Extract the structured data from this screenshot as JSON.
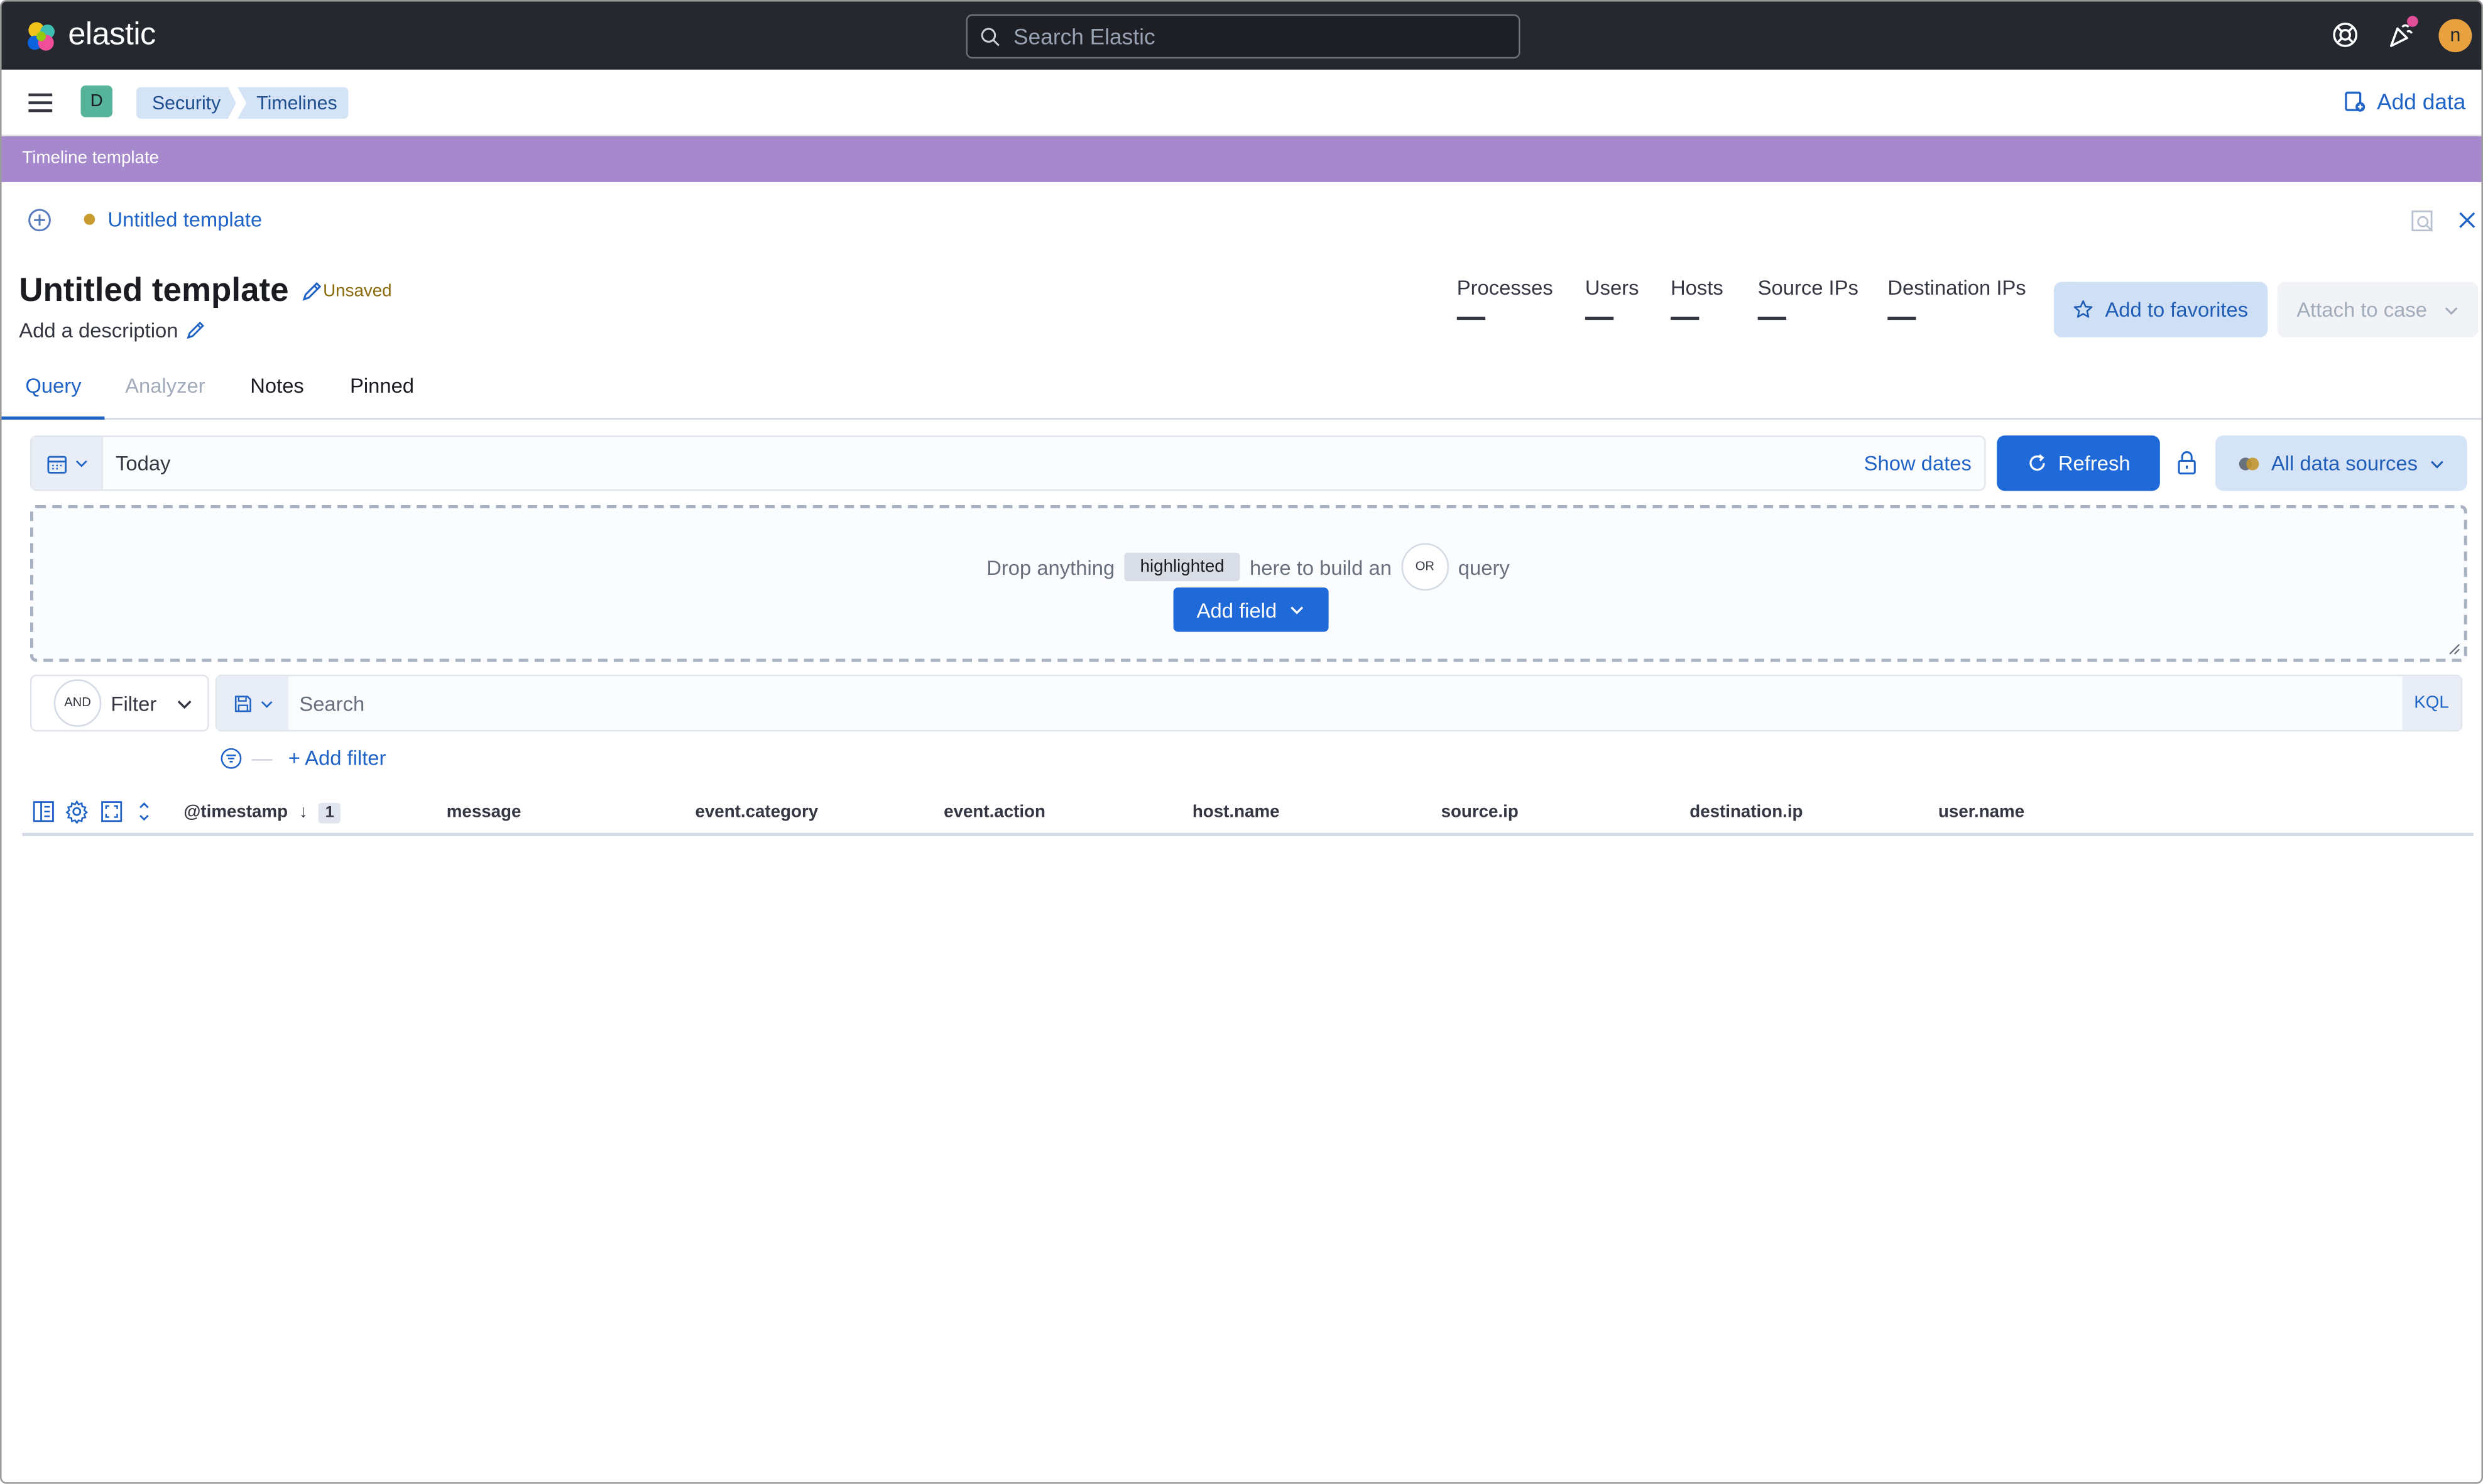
{
  "header": {
    "logo_text": "elastic",
    "search_placeholder": "Search Elastic",
    "avatar_initial": "n"
  },
  "nav": {
    "space_initial": "D",
    "breadcrumbs": [
      "Security",
      "Timelines"
    ],
    "add_data_label": "Add data"
  },
  "banner": {
    "text": "Timeline template"
  },
  "timeline": {
    "tab_title": "Untitled template",
    "title": "Untitled template",
    "status": "Unsaved",
    "description_placeholder": "Add a description",
    "kpis": [
      {
        "label": "Processes",
        "value": "—"
      },
      {
        "label": "Users",
        "value": "—"
      },
      {
        "label": "Hosts",
        "value": "—"
      },
      {
        "label": "Source IPs",
        "value": "—"
      },
      {
        "label": "Destination IPs",
        "value": "—"
      }
    ],
    "favorites_label": "Add to favorites",
    "attach_label": "Attach to case"
  },
  "tabs": [
    {
      "label": "Query",
      "state": "active"
    },
    {
      "label": "Analyzer",
      "state": "disabled"
    },
    {
      "label": "Notes",
      "state": "normal"
    },
    {
      "label": "Pinned",
      "state": "normal"
    }
  ],
  "query": {
    "date_value": "Today",
    "show_dates_label": "Show dates",
    "refresh_label": "Refresh",
    "sources_label": "All data sources",
    "drop_prefix": "Drop anything",
    "drop_highlight": "highlighted",
    "drop_middle": "here to build an",
    "drop_or": "OR",
    "drop_suffix": "query",
    "add_field_label": "Add field",
    "filter_and": "AND",
    "filter_label": "Filter",
    "search_placeholder": "Search",
    "language": "KQL",
    "add_filter_label": "+ Add filter"
  },
  "grid": {
    "columns": [
      "@timestamp",
      "message",
      "event.category",
      "event.action",
      "host.name",
      "source.ip",
      "destination.ip",
      "user.name"
    ],
    "sort_count": "1"
  },
  "colors": {
    "header_bg": "#25282f",
    "banner_bg": "#a688cc",
    "primary": "#1f6ad8",
    "link": "#1f63c6"
  }
}
